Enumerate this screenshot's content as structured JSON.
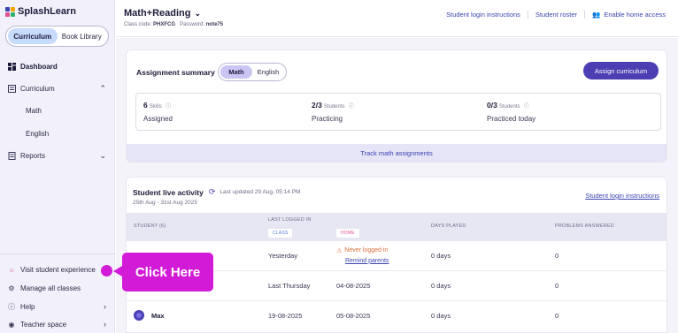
{
  "app": {
    "brand": "SplashLearn",
    "brand_colors": [
      "#3a44b0",
      "#f2a400",
      "#e0508f",
      "#2fb36b"
    ]
  },
  "sidebar": {
    "tabs": [
      {
        "label": "Curriculum",
        "active": true
      },
      {
        "label": "Book Library",
        "active": false
      }
    ],
    "nav": [
      {
        "label": "Dashboard",
        "icon": "dashboard-grid-icon",
        "active": true
      },
      {
        "label": "Curriculum",
        "icon": "curriculum-list-icon",
        "expanded": true
      },
      {
        "label": "Reports",
        "icon": "report-doc-icon",
        "expanded": false
      }
    ],
    "curriculum_children": [
      "Math",
      "English"
    ],
    "bottom": [
      {
        "label": "Visit student experience",
        "icon": "visit-student-icon"
      },
      {
        "label": "Manage all classes",
        "icon": "gear-icon"
      },
      {
        "label": "Help",
        "icon": "help-circle-icon"
      },
      {
        "label": "Teacher space",
        "icon": "teacher-space-icon"
      }
    ]
  },
  "header": {
    "title": "Math+Reading",
    "class_code_label": "Class code:",
    "class_code": "PHXFCG",
    "password_label": "Password:",
    "password": "note75",
    "links": [
      "Student login instructions",
      "Student roster",
      "Enable home access"
    ]
  },
  "assignment_summary": {
    "title": "Assignment summary",
    "subjects": [
      {
        "label": "Math",
        "active": true
      },
      {
        "label": "English",
        "active": false
      }
    ],
    "button": "Assign curriculum",
    "stats": [
      {
        "value": "6",
        "unit": "Skills",
        "label": "Assigned"
      },
      {
        "value": "2/3",
        "unit": "Students",
        "label": "Practicing"
      },
      {
        "value": "0/3",
        "unit": "Students",
        "label": "Practiced today"
      }
    ],
    "track_link": "Track math assignments"
  },
  "live_activity": {
    "title": "Student live activity",
    "last_updated": "Last updated 29 Aug, 05:14 PM",
    "date_range": "25th Aug - 31st Aug 2025",
    "login_link": "Student login instructions",
    "columns": {
      "student": "STUDENT (6)",
      "last_logged_in": "LAST LOGGED IN",
      "class_tag": "CLASS",
      "home_tag": "HOME",
      "days_played": "DAYS PLAYED",
      "problems_answered": "PROBLEMS ANSWERED"
    },
    "rows": [
      {
        "name": "",
        "class": "Yesterday",
        "home_warning": "Never logged in",
        "home_action": "Remind parents",
        "days": "0 days",
        "problems": "0"
      },
      {
        "name": "",
        "class": "Last Thursday",
        "home": "04-08-2025",
        "days": "0 days",
        "problems": "0"
      },
      {
        "name": "Max",
        "class": "19-08-2025",
        "home": "05-08-2025",
        "days": "0 days",
        "problems": "0"
      }
    ]
  },
  "callout": {
    "text": "Click Here",
    "color": "#d21bd6"
  }
}
